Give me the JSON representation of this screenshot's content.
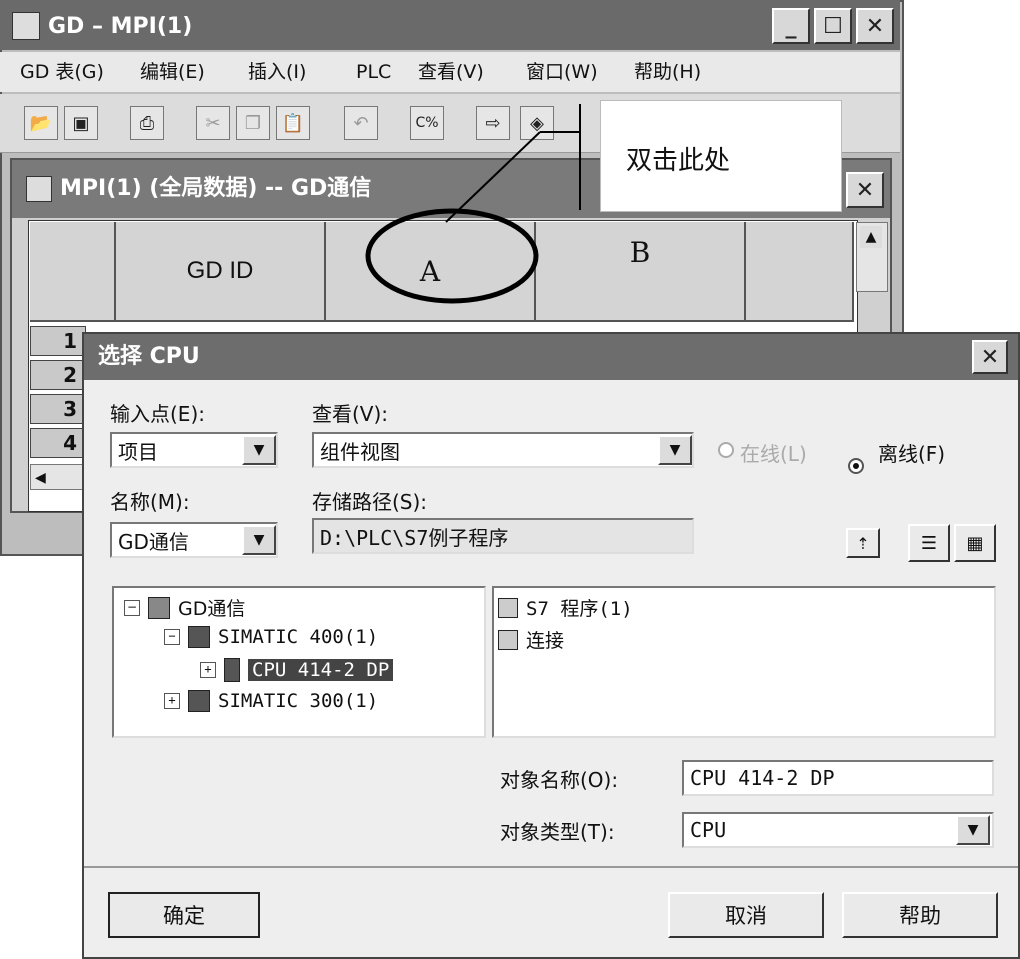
{
  "main_window": {
    "title": "GD – MPI(1)",
    "menu": [
      "GD 表(G)",
      "编辑(E)",
      "插入(I)",
      "PLC",
      "查看(V)",
      "窗口(W)",
      "帮助(H)"
    ],
    "toolbar_icons": [
      "open-icon",
      "save-icon",
      "print-icon",
      "cut-icon",
      "copy-icon",
      "paste-icon",
      "undo-icon",
      "compile-icon",
      "download-icon",
      "select-cpu-icon"
    ]
  },
  "inner_window": {
    "title": "MPI(1) (全局数据) -- GD通信",
    "columns": [
      "GD ID",
      "A",
      "B"
    ],
    "rows": [
      "1",
      "2",
      "3",
      "4"
    ]
  },
  "callout": {
    "text": "双击此处"
  },
  "dialog": {
    "title": "选择 CPU",
    "entry_point_label": "输入点(E):",
    "entry_point_value": "项目",
    "view_label": "查看(V):",
    "view_value": "组件视图",
    "online_label": "在线(L)",
    "offline_label": "离线(F)",
    "name_label": "名称(M):",
    "name_value": "GD通信",
    "path_label": "存储路径(S):",
    "path_value": "D:\\PLC\\S7例子程序",
    "tree": [
      {
        "label": "GD通信",
        "sign": "−"
      },
      {
        "label": "SIMATIC 400(1)",
        "sign": "−"
      },
      {
        "label": "CPU 414-2 DP",
        "sign": "+"
      },
      {
        "label": "SIMATIC 300(1)",
        "sign": "+"
      }
    ],
    "contents": [
      "S7 程序(1)",
      "连接"
    ],
    "object_name_label": "对象名称(O):",
    "object_name_value": "CPU 414-2 DP",
    "object_type_label": "对象类型(T):",
    "object_type_value": "CPU",
    "ok_label": "确定",
    "cancel_label": "取消",
    "help_label": "帮助"
  }
}
